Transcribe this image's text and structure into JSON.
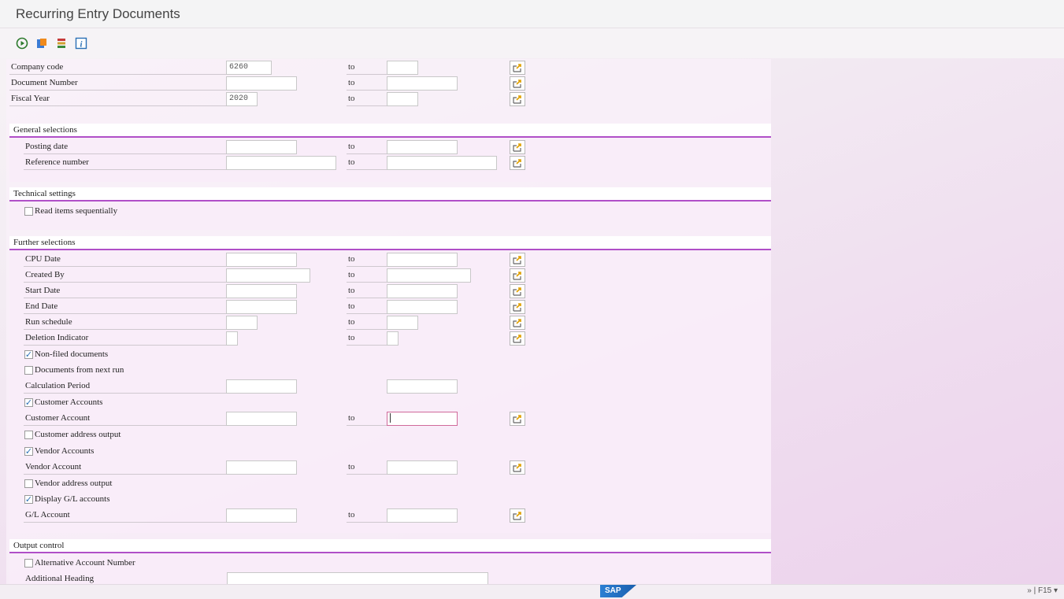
{
  "window": {
    "title": "Recurring Entry Documents"
  },
  "toolbar": {
    "icons": [
      "execute-icon",
      "variant-icon",
      "selection-list-icon",
      "info-icon"
    ]
  },
  "common": {
    "to_label": "to"
  },
  "header_fields": [
    {
      "label": "Company code",
      "value": "6260",
      "to_value": ""
    },
    {
      "label": "Document Number",
      "value": "",
      "to_value": ""
    },
    {
      "label": "Fiscal Year",
      "value": "2020",
      "to_value": ""
    }
  ],
  "groups": {
    "general": {
      "title": "General selections",
      "fields": [
        {
          "label": "Posting date",
          "value": "",
          "to_value": ""
        },
        {
          "label": "Reference number",
          "value": "",
          "to_value": ""
        }
      ]
    },
    "technical": {
      "title": "Technical settings",
      "checkbox": {
        "label": "Read items sequentially",
        "checked": false
      }
    },
    "further": {
      "title": "Further selections",
      "fields": [
        {
          "label": "CPU Date"
        },
        {
          "label": "Created By"
        },
        {
          "label": "Start Date"
        },
        {
          "label": "End Date"
        },
        {
          "label": "Run schedule"
        },
        {
          "label": "Deletion Indicator"
        }
      ],
      "chk_nonfiled": {
        "label": "Non-filed documents",
        "checked": true
      },
      "chk_nextrun": {
        "label": "Documents from next run",
        "checked": false
      },
      "calc_period": {
        "label": "Calculation Period"
      },
      "chk_customer": {
        "label": "Customer Accounts",
        "checked": true
      },
      "customer_account": {
        "label": "Customer Account"
      },
      "chk_cust_addr": {
        "label": "Customer address output",
        "checked": false
      },
      "chk_vendor": {
        "label": "Vendor Accounts",
        "checked": true
      },
      "vendor_account": {
        "label": "Vendor Account"
      },
      "chk_vend_addr": {
        "label": "Vendor address output",
        "checked": false
      },
      "chk_gl": {
        "label": "Display G/L accounts",
        "checked": true
      },
      "gl_account": {
        "label": "G/L Account"
      }
    },
    "output": {
      "title": "Output control",
      "chk_alt": {
        "label": "Alternative Account Number",
        "checked": false
      },
      "add_heading": {
        "label": "Additional Heading",
        "value": ""
      }
    }
  },
  "status": {
    "logo": "SAP",
    "system": "» | F15 ▾"
  },
  "colors": {
    "accent": "#b04fc8",
    "background": "#efdcef"
  }
}
